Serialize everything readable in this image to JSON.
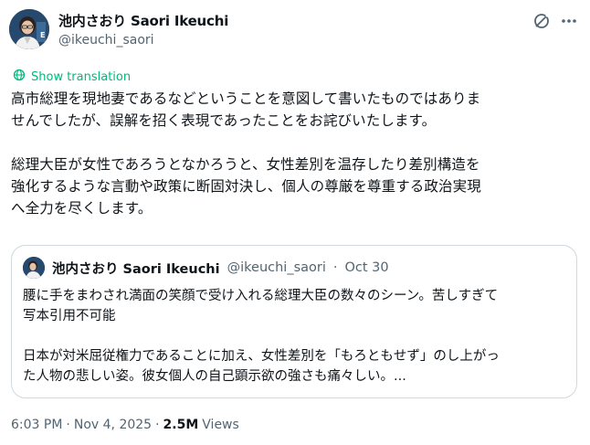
{
  "author": {
    "display_name": "池内さおり Saori Ikeuchi",
    "handle": "@ikeuchi_saori"
  },
  "icons": {
    "grok": "grok-slash-circle-icon",
    "more": "more-horizontal-icon",
    "translate": "globe-translate-icon"
  },
  "translation": {
    "label": "Show translation"
  },
  "tweet": {
    "text": "高市総理を現地妻であるなどということを意図して書いたものではありま\nせんでしたが、誤解を招く表現であったことをお詫びいたします。\n\n総理大臣が女性であろうとなかろうと、女性差別を温存したり差別構造を\n強化するような言動や政策に断固対決し、個人の尊厳を尊重する政治実現\nへ全力を尽くします。"
  },
  "quote": {
    "display_name": "池内さおり Saori Ikeuchi",
    "handle": "@ikeuchi_saori",
    "separator": "·",
    "date": "Oct 30",
    "text": "腰に手をまわされ満面の笑顔で受け入れる総理大臣の数々のシーン。苦しすぎて\n写本引用不可能\n\n日本が対米屈従権力であることに加え、女性差別を「もろともせず」のし上がっ\nた人物の悲しい姿。彼女個人の自己顕示欲の強さも痛々しい。..."
  },
  "footer": {
    "time": "6:03 PM",
    "separator1": "·",
    "date": "Nov 4, 2025",
    "separator2": "·",
    "views_count": "2.5M",
    "views_label": "Views"
  },
  "colors": {
    "text": "#0f1419",
    "secondary": "#536471",
    "translate": "#00ba7c",
    "border": "#cfd9de"
  }
}
